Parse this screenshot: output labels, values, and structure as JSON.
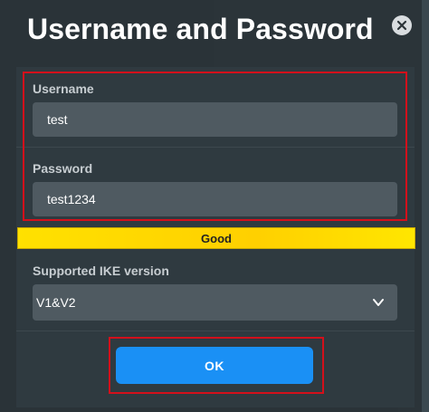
{
  "dialog": {
    "title": "Username and Password",
    "close_icon": "close-icon"
  },
  "username": {
    "label": "Username",
    "value": "test"
  },
  "password": {
    "label": "Password",
    "value": "test1234"
  },
  "strength": {
    "label": "Good",
    "color": "#ffe100"
  },
  "ike": {
    "label": "Supported IKE version",
    "selected": "V1&V2",
    "chevron_icon": "chevron-down-icon"
  },
  "actions": {
    "ok_label": "OK",
    "ok_color": "#1a90f5"
  },
  "highlight_color": "#d3101b"
}
